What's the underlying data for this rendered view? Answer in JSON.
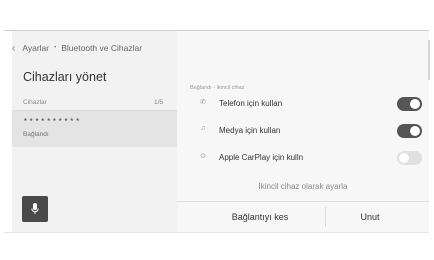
{
  "header": {
    "breadcrumb": [
      "Ayarlar",
      "Bluetooth ve Cihazlar"
    ]
  },
  "left": {
    "title": "Cihazları yönet",
    "section_label": "Cihazlar",
    "section_count": "1/5",
    "device": {
      "name": "**********",
      "status": "Bağlandı"
    }
  },
  "right": {
    "header": "Bağlandı - ikincil cihaz",
    "settings": [
      {
        "label": "Telefon için kullan",
        "icon": "phone-icon",
        "enabled": true
      },
      {
        "label": "Medya için kullan",
        "icon": "music-note-icon",
        "enabled": true
      },
      {
        "label": "Apple CarPlay için kulln",
        "icon": "carplay-icon",
        "enabled": false
      }
    ],
    "secondary_link": "İkincil cihaz olarak ayarla",
    "buttons": {
      "disconnect": "Bağlantıyı kes",
      "forget": "Unut"
    }
  },
  "colors": {
    "toggle_on": "#555555",
    "toggle_off": "#e0e0e0",
    "selected_item": "#e4e4e4"
  }
}
